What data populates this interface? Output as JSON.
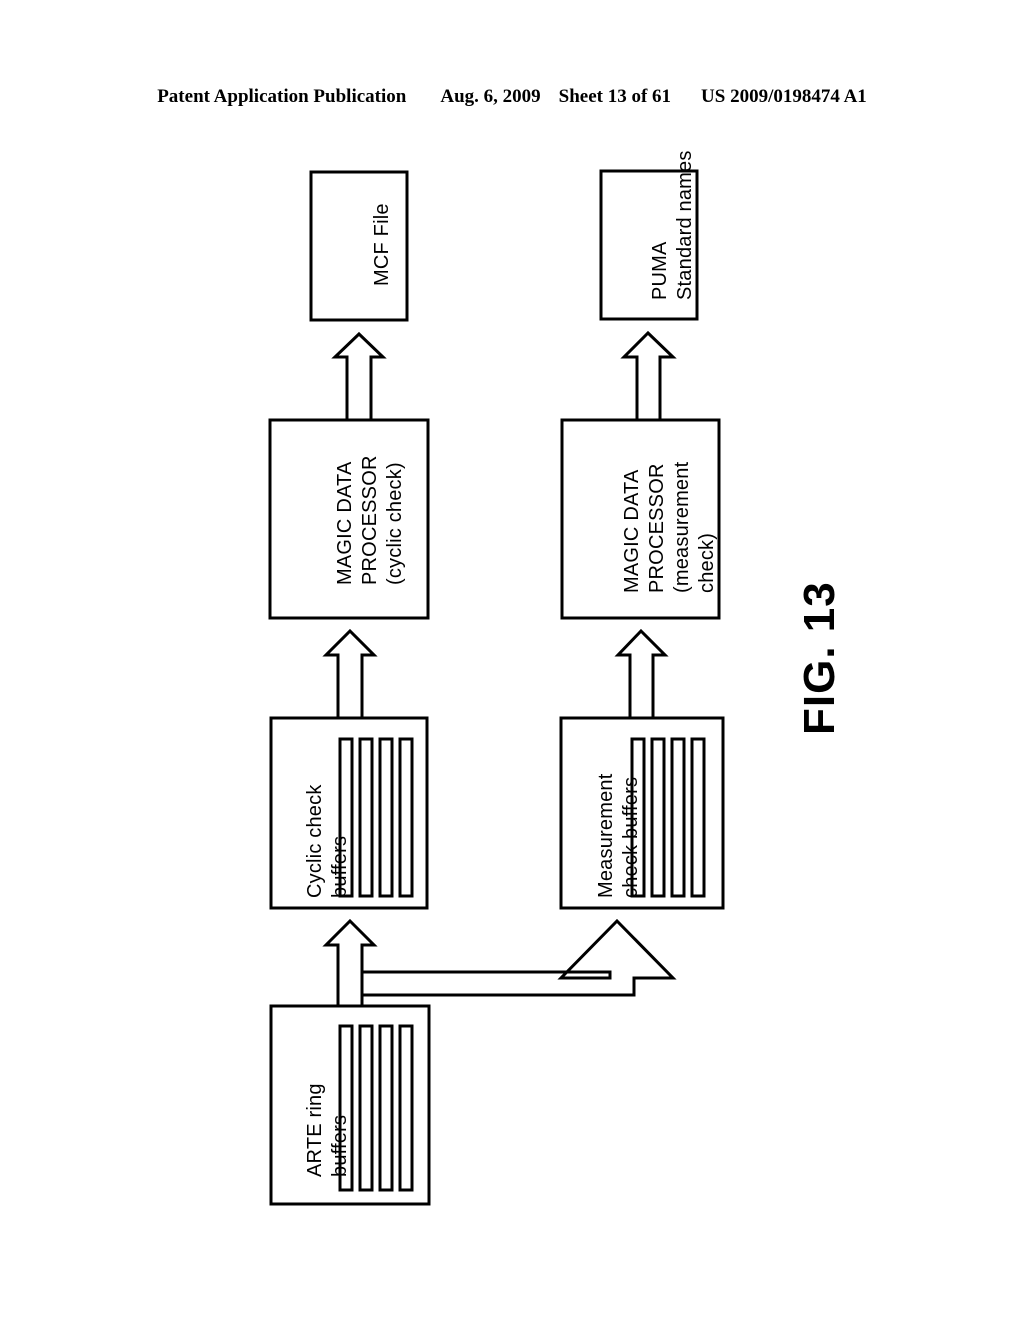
{
  "header": {
    "publication": "Patent Application Publication",
    "date": "Aug. 6, 2009",
    "sheet": "Sheet 13 of 61",
    "patent_number": "US 2009/0198474 A1"
  },
  "figure": {
    "number_label": "FIG. 13",
    "colors": {
      "stroke": "#000000",
      "fill": "#ffffff"
    },
    "nodes": {
      "mcf_file": {
        "label": "MCF File"
      },
      "puma_standard_names": {
        "line1": "PUMA",
        "line2": "Standard names"
      },
      "mdp_cyclic": {
        "line1": "MAGIC DATA",
        "line2": "PROCESSOR",
        "line3": "(cyclic check)"
      },
      "mdp_measurement": {
        "line1": "MAGIC DATA",
        "line2": "PROCESSOR",
        "line3": "(measurement",
        "line4": "check)"
      },
      "cyclic_check_buffers": {
        "line1": "Cyclic check",
        "line2": "buffers",
        "buffer_count": 4
      },
      "measurement_check_buffers": {
        "line1": "Measurement",
        "line2": "check buffers",
        "buffer_count": 4
      },
      "arte_ring_buffers": {
        "line1": "ARTE ring",
        "line2": "buffers",
        "buffer_count": 4
      }
    },
    "connectors": [
      {
        "name": "mdp-cyclic-to-mcf-file",
        "direction": "up",
        "style": "hollow-block-arrow"
      },
      {
        "name": "mdp-measurement-to-puma",
        "direction": "up",
        "style": "hollow-block-arrow"
      },
      {
        "name": "cyclic-buffers-to-mdp-cyclic",
        "direction": "up",
        "style": "hollow-block-arrow"
      },
      {
        "name": "measurement-buffers-to-mdp-measurement",
        "direction": "up",
        "style": "hollow-block-arrow"
      },
      {
        "name": "arte-buffers-to-cyclic-buffers",
        "direction": "up",
        "style": "hollow-block-arrow"
      },
      {
        "name": "arte-buffers-to-measurement-buffers",
        "direction": "right-then-up",
        "style": "hollow-elbow-arrow"
      }
    ]
  }
}
